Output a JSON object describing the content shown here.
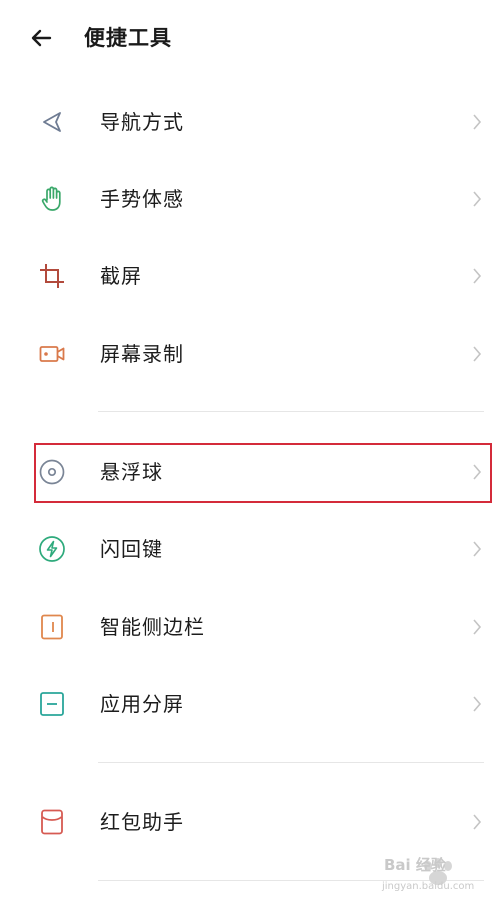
{
  "header": {
    "title": "便捷工具"
  },
  "group1": [
    {
      "label": "导航方式",
      "icon": "navigation-arrow-icon"
    },
    {
      "label": "手势体感",
      "icon": "hand-gesture-icon"
    },
    {
      "label": "截屏",
      "icon": "crop-screenshot-icon"
    },
    {
      "label": "屏幕录制",
      "icon": "screen-record-icon"
    }
  ],
  "group2": [
    {
      "label": "悬浮球",
      "icon": "floating-ball-icon"
    },
    {
      "label": "闪回键",
      "icon": "flash-back-icon"
    },
    {
      "label": "智能侧边栏",
      "icon": "smart-sidebar-icon"
    },
    {
      "label": "应用分屏",
      "icon": "split-screen-icon"
    }
  ],
  "group3": [
    {
      "label": "红包助手",
      "icon": "red-envelope-icon"
    }
  ],
  "watermark": {
    "text": "Bai 经验",
    "url": "jingyan.baidu.com"
  },
  "colors": {
    "highlight": "#d42b3a",
    "nav": "#6f7c93",
    "gesture": "#3aa86a",
    "crop": "#b24a3c",
    "record": "#d9794b",
    "floating": "#7a8596",
    "flash": "#2eaa7c",
    "sidebar": "#e0874d",
    "split": "#2aa69a",
    "envelope": "#d65a52"
  }
}
